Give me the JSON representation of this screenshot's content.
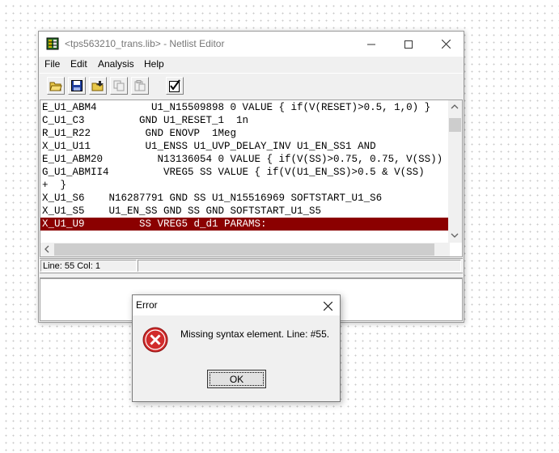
{
  "window": {
    "title": "<tps563210_trans.lib> - Netlist Editor",
    "icon": "netlist-app-icon"
  },
  "menu": [
    "File",
    "Edit",
    "Analysis",
    "Help"
  ],
  "toolbar": {
    "icons": [
      "open-folder-icon",
      "save-icon",
      "open-file-icon",
      "copy-icon",
      "paste-icon",
      "check-icon"
    ]
  },
  "editor": {
    "lines": [
      "E_U1_ABM4         U1_N15509898 0 VALUE { if(V(RESET)>0.5, 1,0) }",
      "C_U1_C3         GND U1_RESET_1  1n",
      "R_U1_R22         GND ENOVP  1Meg",
      "X_U1_U11         U1_ENSS U1_UVP_DELAY_INV U1_EN_SS1 AND",
      "E_U1_ABM20         N13136054 0 VALUE { if(V(SS)>0.75, 0.75, V(SS)) }",
      "G_U1_ABMII4         VREG5 SS VALUE { if(V(U1_EN_SS)>0.5 & V(SS)",
      "+  }",
      "X_U1_S6    N16287791 GND SS U1_N15516969 SOFTSTART_U1_S6",
      "X_U1_S5    U1_EN_SS GND SS GND SOFTSTART_U1_S5",
      "X_U1_U9         SS VREG5 d_d1 PARAMS:"
    ],
    "selected_line_index": 9,
    "selection_color": "#8b0000"
  },
  "status": {
    "position": "Line: 55 Col: 1"
  },
  "dialog": {
    "title": "Error",
    "message": "Missing syntax element. Line: #55.",
    "ok_label": "OK",
    "icon": "error-icon"
  }
}
